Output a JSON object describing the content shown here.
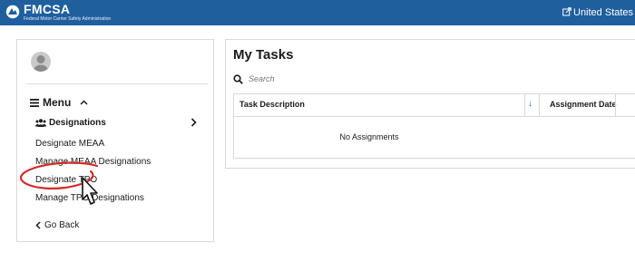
{
  "header": {
    "logo_title": "FMCSA",
    "logo_subtitle": "Federal Motor Carrier Safety Administration",
    "external_link": "United States Depa"
  },
  "sidebar": {
    "menu_label": "Menu",
    "group_label": "Designations",
    "items": [
      {
        "label": "Designate MEAA"
      },
      {
        "label": "Manage MEAA Designations"
      },
      {
        "label": "Designate TPO"
      },
      {
        "label": "Manage TPO Designations"
      }
    ],
    "go_back": "Go Back"
  },
  "tasks": {
    "title": "My Tasks",
    "search_placeholder": "Search",
    "columns": [
      "Task Description",
      "Assignment Date"
    ],
    "empty_message": "No Assignments"
  },
  "colors": {
    "header_bg": "#1f5f9e",
    "annotation": "#d42a2a"
  },
  "icons": [
    "logo-mark-icon",
    "external-link-icon",
    "hamburger-icon",
    "chevron-up-icon",
    "users-icon",
    "chevron-right-icon",
    "chevron-left-icon",
    "search-icon",
    "sort-down-arrow-icon",
    "mouse-pointer-icon"
  ]
}
